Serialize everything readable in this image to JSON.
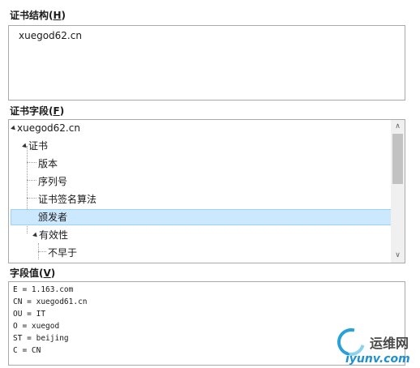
{
  "structure": {
    "label_text": "证书结构(",
    "label_key": "H",
    "label_end": ")",
    "root": "xuegod62.cn"
  },
  "fields": {
    "label_text": "证书字段(",
    "label_key": "F",
    "label_end": ")",
    "tree": [
      {
        "label": "xuegod62.cn",
        "level": 0,
        "expanded": true,
        "selected": false
      },
      {
        "label": "证书",
        "level": 1,
        "expanded": true,
        "selected": false
      },
      {
        "label": "版本",
        "level": 2,
        "expanded": false,
        "selected": false
      },
      {
        "label": "序列号",
        "level": 2,
        "expanded": false,
        "selected": false
      },
      {
        "label": "证书签名算法",
        "level": 2,
        "expanded": false,
        "selected": false
      },
      {
        "label": "颁发者",
        "level": 2,
        "expanded": false,
        "selected": true
      },
      {
        "label": "有效性",
        "level": 2,
        "expanded": true,
        "selected": false
      },
      {
        "label": "不早于",
        "level": 3,
        "expanded": false,
        "selected": false
      }
    ],
    "scrollbar": {
      "up_icon": "chevron-up-icon",
      "down_icon": "chevron-down-icon"
    }
  },
  "value": {
    "label_text": "字段值(",
    "label_key": "V",
    "label_end": ")",
    "lines": [
      "E = 1.163.com",
      "CN = xuegod61.cn",
      "OU = IT",
      "O = xuegod",
      "ST = beijing",
      "C = CN"
    ]
  },
  "watermark": {
    "cn": "运维网",
    "url": "iyunv.com",
    "color": "#27a1d8"
  },
  "colors": {
    "selection_bg": "#cce8ff",
    "selection_border": "#99d1ff",
    "border": "#a9a9a9"
  }
}
